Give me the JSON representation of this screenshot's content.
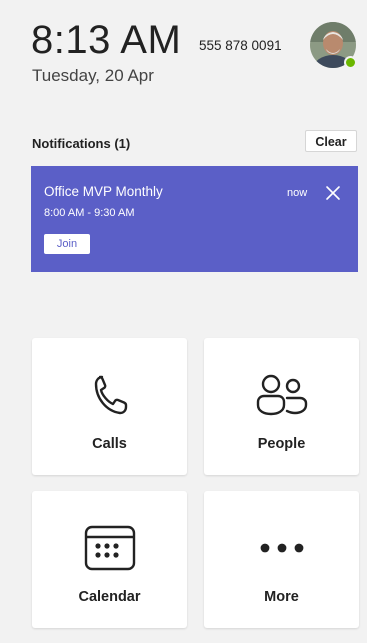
{
  "header": {
    "time": "8:13 AM",
    "date": "Tuesday, 20 Apr",
    "phone_number": "555 878 0091",
    "avatar_icon": "user-avatar",
    "presence_status_color": "#6bb700"
  },
  "notifications": {
    "title": "Notifications (1)",
    "clear_label": "Clear",
    "items": [
      {
        "title": "Office MVP Monthly",
        "time_range": "8:00 AM - 9:30 AM",
        "when": "now",
        "join_label": "Join",
        "close_icon": "close-icon"
      }
    ],
    "accent_color": "#5b5fc7"
  },
  "tiles": [
    {
      "label": "Calls",
      "icon": "phone-icon"
    },
    {
      "label": "People",
      "icon": "people-icon"
    },
    {
      "label": "Calendar",
      "icon": "calendar-icon"
    },
    {
      "label": "More",
      "icon": "more-icon"
    }
  ]
}
